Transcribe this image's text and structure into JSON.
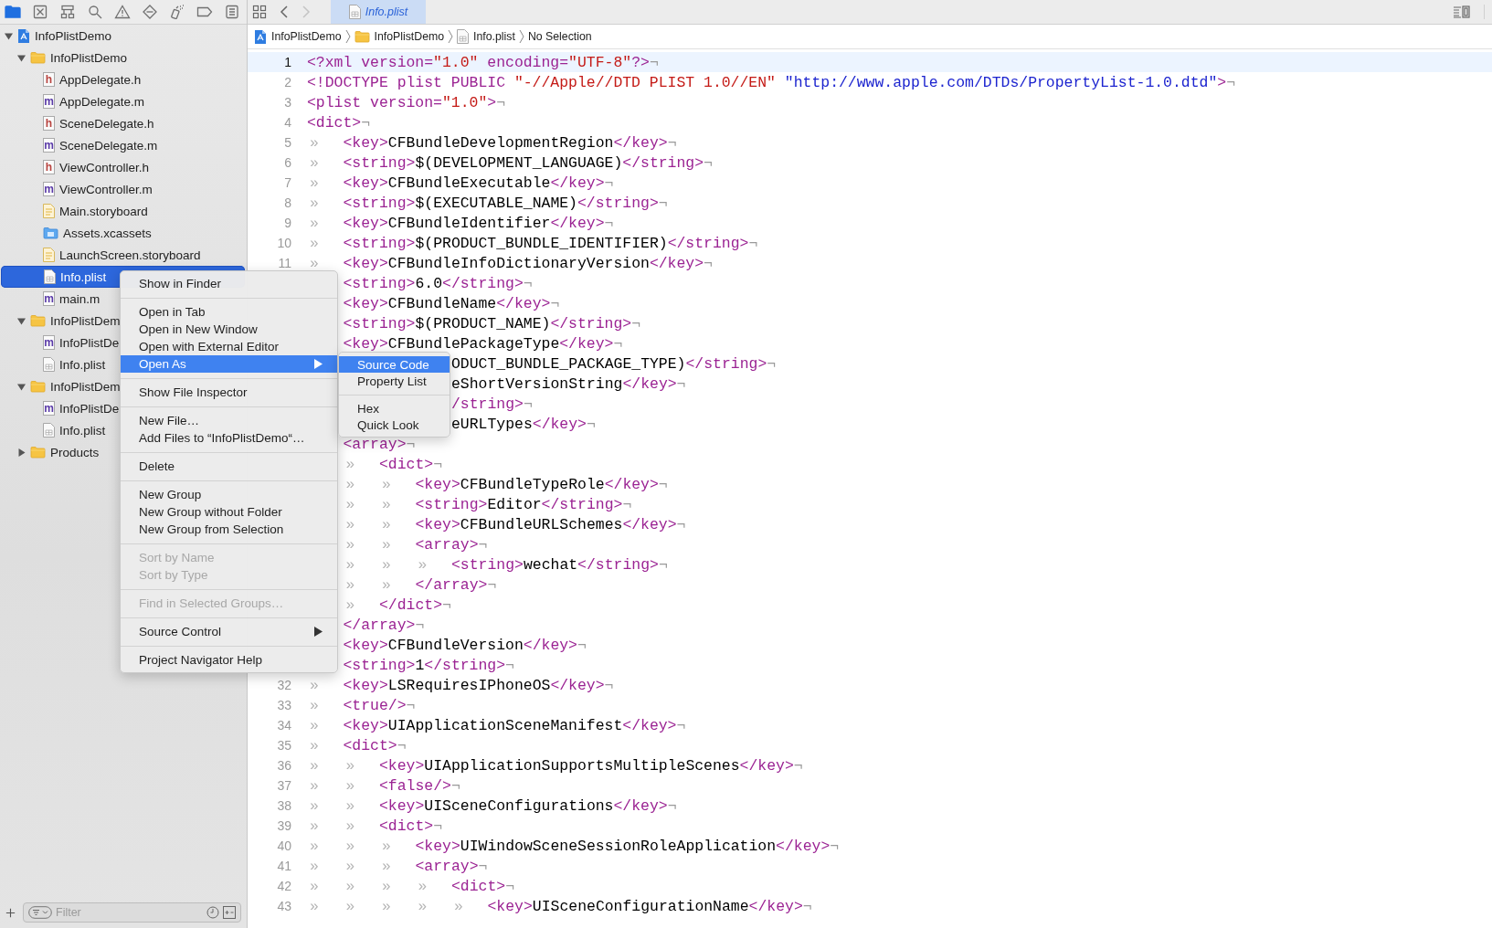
{
  "navigator_tabs": [
    {
      "kind": "folder",
      "selected": true
    },
    {
      "kind": "x-square",
      "selected": false
    },
    {
      "kind": "hierarchy",
      "selected": false
    },
    {
      "kind": "search",
      "selected": false
    },
    {
      "kind": "warning",
      "selected": false
    },
    {
      "kind": "diamond",
      "selected": false
    },
    {
      "kind": "spray",
      "selected": false
    },
    {
      "kind": "tag",
      "selected": false
    },
    {
      "kind": "list",
      "selected": false
    }
  ],
  "navigator": {
    "items": [
      {
        "name": "InfoPlistDemo",
        "kind": "project",
        "expanded": true,
        "selected": false,
        "children": [
          {
            "name": "InfoPlistDemo",
            "kind": "folder",
            "expanded": true,
            "selected": false,
            "children": [
              {
                "name": "AppDelegate.h",
                "kind": "source",
                "letter": "h",
                "color": "#b8433f",
                "selected": false
              },
              {
                "name": "AppDelegate.m",
                "kind": "source",
                "letter": "m",
                "color": "#5a3aa8",
                "selected": false
              },
              {
                "name": "SceneDelegate.h",
                "kind": "source",
                "letter": "h",
                "color": "#b8433f",
                "selected": false
              },
              {
                "name": "SceneDelegate.m",
                "kind": "source",
                "letter": "m",
                "color": "#5a3aa8",
                "selected": false
              },
              {
                "name": "ViewController.h",
                "kind": "source",
                "letter": "h",
                "color": "#b8433f",
                "selected": false
              },
              {
                "name": "ViewController.m",
                "kind": "source",
                "letter": "m",
                "color": "#5a3aa8",
                "selected": false
              },
              {
                "name": "Main.storyboard",
                "kind": "storyboard",
                "selected": false
              },
              {
                "name": "Assets.xcassets",
                "kind": "assets",
                "selected": false
              },
              {
                "name": "LaunchScreen.storyboard",
                "kind": "storyboard",
                "selected": false
              },
              {
                "name": "Info.plist",
                "kind": "plist",
                "selected": true
              },
              {
                "name": "main.m",
                "kind": "source",
                "letter": "m",
                "color": "#5a3aa8",
                "selected": false
              }
            ]
          },
          {
            "name": "InfoPlistDem",
            "kind": "folder",
            "expanded": true,
            "selected": false,
            "children": [
              {
                "name": "InfoPlistDe",
                "kind": "source",
                "letter": "m",
                "color": "#5a3aa8",
                "selected": false
              },
              {
                "name": "Info.plist",
                "kind": "plist",
                "selected": false
              }
            ]
          },
          {
            "name": "InfoPlistDem",
            "kind": "folder",
            "expanded": true,
            "selected": false,
            "children": [
              {
                "name": "InfoPlistDe",
                "kind": "source",
                "letter": "m",
                "color": "#5a3aa8",
                "selected": false
              },
              {
                "name": "Info.plist",
                "kind": "plist",
                "selected": false
              }
            ]
          },
          {
            "name": "Products",
            "kind": "folder",
            "expanded": false,
            "selected": false
          }
        ]
      }
    ]
  },
  "filter": {
    "placeholder": "Filter"
  },
  "nav_buttons": [
    {
      "kind": "back",
      "disabled": false
    },
    {
      "kind": "forward",
      "disabled": true
    }
  ],
  "tabs": [
    {
      "label": "Info.plist",
      "selected": true
    }
  ],
  "breadcrumbs": [
    {
      "label": "InfoPlistDemo",
      "kind": "project"
    },
    {
      "label": "InfoPlistDemo",
      "kind": "folder"
    },
    {
      "label": "Info.plist",
      "kind": "plist"
    },
    {
      "label": "No Selection",
      "kind": "text"
    }
  ],
  "code": {
    "lines": [
      {
        "kind": "code",
        "number": "1",
        "current": true,
        "code": "<?xml version=\"1.0\" encoding=\"UTF-8\"?>",
        "eol": "¬"
      },
      {
        "kind": "code",
        "number": "2",
        "current": false,
        "code": "<!DOCTYPE plist PUBLIC \"-//Apple//DTD PLIST 1.0//EN\" \"http://www.apple.com/DTDs/PropertyList-1.0.dtd\">",
        "eol": "¬"
      },
      {
        "kind": "code",
        "number": "3",
        "current": false,
        "code": "<plist version=\"1.0\">",
        "eol": "¬"
      },
      {
        "kind": "code",
        "number": "4",
        "current": false,
        "code": "<dict>",
        "eol": "¬"
      },
      {
        "kind": "code",
        "number": "5",
        "current": false,
        "tabs": [
          "»"
        ],
        "code": "<key>CFBundleDevelopmentRegion</key>",
        "eol": "¬"
      },
      {
        "kind": "code",
        "number": "6",
        "current": false,
        "tabs": [
          "»"
        ],
        "code": "<string>$(DEVELOPMENT_LANGUAGE)</string>",
        "eol": "¬"
      },
      {
        "kind": "code",
        "number": "7",
        "current": false,
        "tabs": [
          "»"
        ],
        "code": "<key>CFBundleExecutable</key>",
        "eol": "¬"
      },
      {
        "kind": "code",
        "number": "8",
        "current": false,
        "tabs": [
          "»"
        ],
        "code": "<string>$(EXECUTABLE_NAME)</string>",
        "eol": "¬"
      },
      {
        "kind": "code",
        "number": "9",
        "current": false,
        "tabs": [
          "»"
        ],
        "code": "<key>CFBundleIdentifier</key>",
        "eol": "¬"
      },
      {
        "kind": "code",
        "number": "10",
        "current": false,
        "tabs": [
          "»"
        ],
        "code": "<string>$(PRODUCT_BUNDLE_IDENTIFIER)</string>",
        "eol": "¬"
      },
      {
        "kind": "code",
        "number": "11",
        "current": false,
        "tabs": [
          "»"
        ],
        "code": "<key>CFBundleInfoDictionaryVersion</key>",
        "eol": "¬"
      },
      {
        "kind": "covered",
        "current": false,
        "code": "<string>6.0</string>",
        "eol": "¬"
      },
      {
        "kind": "covered",
        "current": false,
        "code": "<key>CFBundleName</key>",
        "eol": "¬"
      },
      {
        "kind": "covered",
        "current": false,
        "code": "<string>$(PRODUCT_NAME)</string>",
        "eol": "¬"
      },
      {
        "kind": "covered",
        "current": false,
        "code": "<key>CFBundlePackageType</key>",
        "eol": "¬"
      },
      {
        "kind": "cut",
        "current": false,
        "code": "ODUCT_BUNDLE_PACKAGE_TYPE)</string>",
        "eol": "¬"
      },
      {
        "kind": "cut",
        "current": false,
        "code": "eShortVersionString</key>",
        "eol": "¬"
      },
      {
        "kind": "cut",
        "current": false,
        "code": "/string>",
        "eol": "¬"
      },
      {
        "kind": "cut",
        "current": false,
        "code": "eURLTypes</key>",
        "eol": "¬"
      },
      {
        "kind": "covered",
        "current": false,
        "code": "<array>",
        "eol": "¬"
      },
      {
        "kind": "covered",
        "current": false,
        "tabs": [
          "»"
        ],
        "code": "<dict>",
        "eol": "¬"
      },
      {
        "kind": "covered",
        "current": false,
        "tabs": [
          "»",
          "»"
        ],
        "code": "<key>CFBundleTypeRole</key>",
        "eol": "¬"
      },
      {
        "kind": "covered",
        "current": false,
        "tabs": [
          "»",
          "»"
        ],
        "code": "<string>Editor</string>",
        "eol": "¬"
      },
      {
        "kind": "covered",
        "current": false,
        "tabs": [
          "»",
          "»"
        ],
        "code": "<key>CFBundleURLSchemes</key>",
        "eol": "¬"
      },
      {
        "kind": "covered",
        "current": false,
        "tabs": [
          "»",
          "»"
        ],
        "code": "<array>",
        "eol": "¬"
      },
      {
        "kind": "covered",
        "current": false,
        "tabs": [
          "»",
          "»",
          "»"
        ],
        "code": "<string>wechat</string>",
        "eol": "¬"
      },
      {
        "kind": "covered",
        "current": false,
        "tabs": [
          "»",
          "»"
        ],
        "code": "</array>",
        "eol": "¬"
      },
      {
        "kind": "covered",
        "current": false,
        "tabs": [
          "»"
        ],
        "code": "</dict>",
        "eol": "¬"
      },
      {
        "kind": "covered",
        "current": false,
        "code": "</array>",
        "eol": "¬"
      },
      {
        "kind": "covered",
        "current": false,
        "code": "<key>CFBundleVersion</key>",
        "eol": "¬"
      },
      {
        "kind": "covered",
        "current": false,
        "code": "<string>1</string>",
        "eol": "¬"
      },
      {
        "kind": "code",
        "number": "32",
        "current": false,
        "tabs": [
          "»"
        ],
        "code": "<key>LSRequiresIPhoneOS</key>",
        "eol": "¬"
      },
      {
        "kind": "code",
        "number": "33",
        "current": false,
        "tabs": [
          "»"
        ],
        "code": "<true/>",
        "eol": "¬"
      },
      {
        "kind": "code",
        "number": "34",
        "current": false,
        "tabs": [
          "»"
        ],
        "code": "<key>UIApplicationSceneManifest</key>",
        "eol": "¬"
      },
      {
        "kind": "code",
        "number": "35",
        "current": false,
        "tabs": [
          "»"
        ],
        "code": "<dict>",
        "eol": "¬"
      },
      {
        "kind": "code",
        "number": "36",
        "current": false,
        "tabs": [
          "»",
          "»"
        ],
        "code": "<key>UIApplicationSupportsMultipleScenes</key>",
        "eol": "¬"
      },
      {
        "kind": "code",
        "number": "37",
        "current": false,
        "tabs": [
          "»",
          "»"
        ],
        "code": "<false/>",
        "eol": "¬"
      },
      {
        "kind": "code",
        "number": "38",
        "current": false,
        "tabs": [
          "»",
          "»"
        ],
        "code": "<key>UISceneConfigurations</key>",
        "eol": "¬"
      },
      {
        "kind": "code",
        "number": "39",
        "current": false,
        "tabs": [
          "»",
          "»"
        ],
        "code": "<dict>",
        "eol": "¬"
      },
      {
        "kind": "code",
        "number": "40",
        "current": false,
        "tabs": [
          "»",
          "»",
          "»"
        ],
        "code": "<key>UIWindowSceneSessionRoleApplication</key>",
        "eol": "¬"
      },
      {
        "kind": "code",
        "number": "41",
        "current": false,
        "tabs": [
          "»",
          "»",
          "»"
        ],
        "code": "<array>",
        "eol": "¬"
      },
      {
        "kind": "code",
        "number": "42",
        "current": false,
        "tabs": [
          "»",
          "»",
          "»",
          "»"
        ],
        "code": "<dict>",
        "eol": "¬"
      },
      {
        "kind": "code",
        "number": "43",
        "current": false,
        "tabs": [
          "»",
          "»",
          "»",
          "»",
          "»"
        ],
        "code": "<key>UISceneConfigurationName</key>",
        "eol": "¬"
      }
    ]
  },
  "context_menu": {
    "groups": [
      [
        {
          "label": "Show in Finder",
          "selected": false,
          "disabled": false,
          "has_submenu": false
        }
      ],
      [
        {
          "label": "Open in Tab",
          "selected": false,
          "disabled": false,
          "has_submenu": false
        },
        {
          "label": "Open in New Window",
          "selected": false,
          "disabled": false,
          "has_submenu": false
        },
        {
          "label": "Open with External Editor",
          "selected": false,
          "disabled": false,
          "has_submenu": false
        },
        {
          "label": "Open As",
          "selected": true,
          "disabled": false,
          "has_submenu": true
        }
      ],
      [
        {
          "label": "Show File Inspector",
          "selected": false,
          "disabled": false,
          "has_submenu": false
        }
      ],
      [
        {
          "label": "New File…",
          "selected": false,
          "disabled": false,
          "has_submenu": false
        },
        {
          "label": "Add Files to “InfoPlistDemo“…",
          "selected": false,
          "disabled": false,
          "has_submenu": false
        }
      ],
      [
        {
          "label": "Delete",
          "selected": false,
          "disabled": false,
          "has_submenu": false
        }
      ],
      [
        {
          "label": "New Group",
          "selected": false,
          "disabled": false,
          "has_submenu": false
        },
        {
          "label": "New Group without Folder",
          "selected": false,
          "disabled": false,
          "has_submenu": false
        },
        {
          "label": "New Group from Selection",
          "selected": false,
          "disabled": false,
          "has_submenu": false
        }
      ],
      [
        {
          "label": "Sort by Name",
          "selected": false,
          "disabled": true,
          "has_submenu": false
        },
        {
          "label": "Sort by Type",
          "selected": false,
          "disabled": true,
          "has_submenu": false
        }
      ],
      [
        {
          "label": "Find in Selected Groups…",
          "selected": false,
          "disabled": true,
          "has_submenu": false
        }
      ],
      [
        {
          "label": "Source Control",
          "selected": false,
          "disabled": false,
          "has_submenu": true
        }
      ],
      [
        {
          "label": "Project Navigator Help",
          "selected": false,
          "disabled": false,
          "has_submenu": false
        }
      ]
    ]
  },
  "submenu": {
    "groups": [
      [
        {
          "label": "Source Code",
          "selected": true
        },
        {
          "label": "Property List",
          "selected": false
        }
      ],
      [
        {
          "label": "Hex",
          "selected": false
        },
        {
          "label": "Quick Look",
          "selected": false
        }
      ]
    ]
  }
}
